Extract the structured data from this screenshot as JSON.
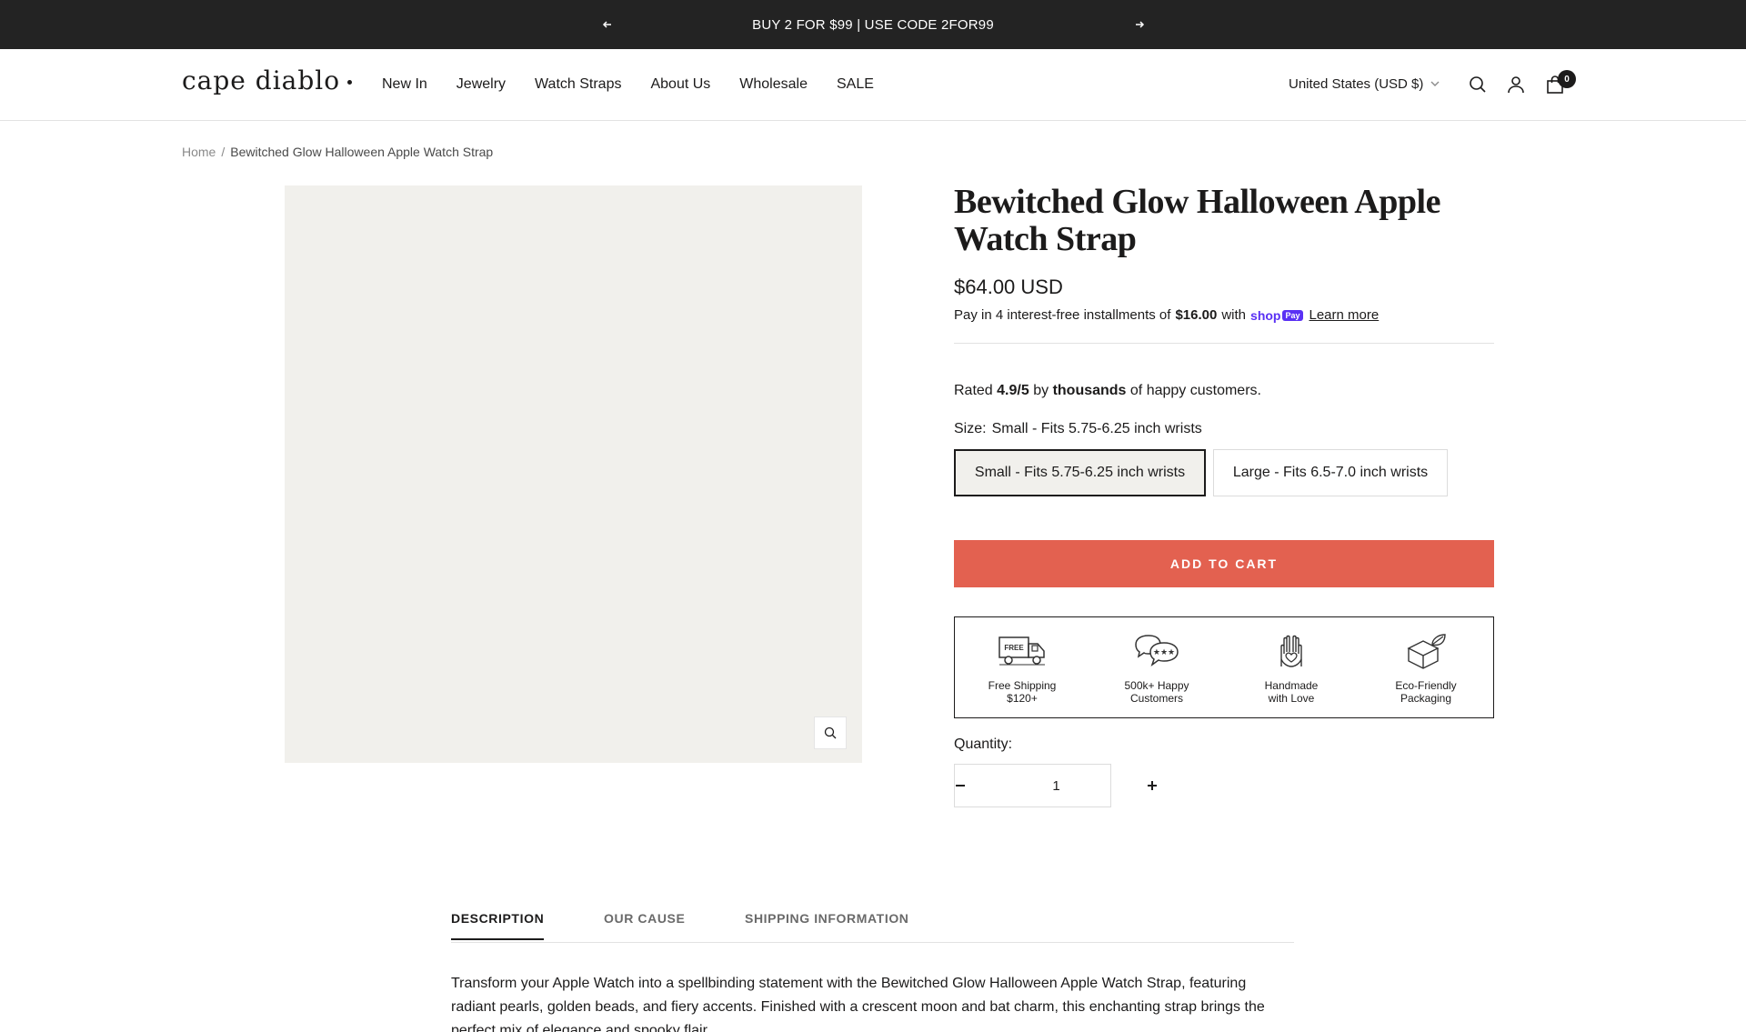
{
  "announcement": {
    "text": "BUY 2 FOR $99 | USE CODE 2FOR99"
  },
  "header": {
    "logo": "cape diablo",
    "nav": [
      "New In",
      "Jewelry",
      "Watch Straps",
      "About Us",
      "Wholesale",
      "SALE"
    ],
    "country": "United States (USD $)",
    "cart_count": "0"
  },
  "breadcrumb": {
    "home": "Home",
    "separator": "/",
    "current": "Bewitched Glow Halloween Apple Watch Strap"
  },
  "product": {
    "title": "Bewitched Glow Halloween Apple Watch Strap",
    "price": "$64.00 USD",
    "installments": {
      "prefix": "Pay in 4 interest-free installments of",
      "amount": "$16.00",
      "with": "with",
      "shop": "shop",
      "pay": "Pay",
      "learn_more": "Learn more"
    },
    "rating": {
      "rated": "Rated",
      "score": "4.9/5",
      "by": "by",
      "thousands": "thousands",
      "suffix": "of happy customers."
    },
    "size": {
      "label": "Size:",
      "selected": "Small - Fits 5.75-6.25 inch wrists",
      "options": [
        "Small - Fits 5.75-6.25 inch wrists",
        "Large - Fits 6.5-7.0 inch wrists"
      ]
    },
    "add_to_cart": "ADD TO CART",
    "features": [
      {
        "icon": "free-shipping-truck-icon",
        "line1": "Free Shipping",
        "line2": "$120+",
        "badge": "FREE"
      },
      {
        "icon": "happy-customers-icon",
        "line1": "500k+ Happy",
        "line2": "Customers"
      },
      {
        "icon": "handmade-heart-hands-icon",
        "line1": "Handmade",
        "line2": "with Love"
      },
      {
        "icon": "eco-packaging-box-icon",
        "line1": "Eco-Friendly",
        "line2": "Packaging"
      }
    ],
    "quantity": {
      "label": "Quantity:",
      "value": "1"
    }
  },
  "tabs": [
    "DESCRIPTION",
    "OUR CAUSE",
    "SHIPPING INFORMATION"
  ],
  "description": "Transform your Apple Watch into a spellbinding statement with the Bewitched Glow Halloween Apple Watch Strap, featuring radiant pearls, golden beads, and fiery accents. Finished with a crescent moon and bat charm, this enchanting strap brings the perfect mix of elegance and spooky flair.",
  "colors": {
    "announcement_bg": "#232323",
    "add_to_cart_bg": "#e36150",
    "gallery_bg": "#f1f0ec",
    "shop_pay": "#5a31f4"
  }
}
